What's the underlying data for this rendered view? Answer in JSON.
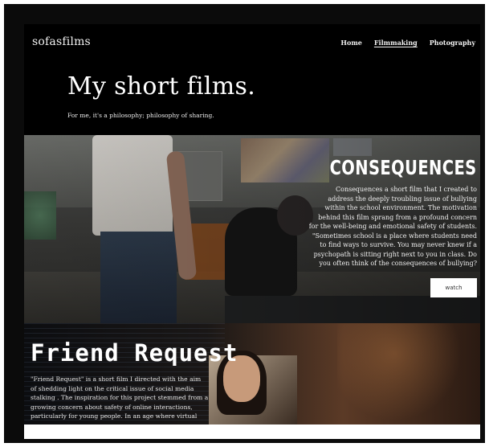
{
  "nav": {
    "brand": "sofasfilms",
    "links": [
      {
        "label": "Home",
        "active": false
      },
      {
        "label": "Filmmaking",
        "active": true
      },
      {
        "label": "Photography",
        "active": false
      }
    ]
  },
  "hero": {
    "title": "My short films.",
    "subtitle": "For me, it's a philosophy; philosophy of sharing."
  },
  "films": [
    {
      "title": "CONSEQUENCES",
      "description": "Consequences a short film that I created to address the deeply troubling issue of bullying within the school environment. The motivation behind this film sprang from a profound concern for the well-being and emotional safety of students. \"Sometimes school is a place where students need to find ways to survive. You may never knew if a psychopath is sitting right next to you in class. Do you often think of the consequences of bullying?",
      "button": "watch"
    },
    {
      "title": "Friend Request",
      "description": "\"Friend Request\" is a short film I directed with the aim of shedding light on the critical issue of social media stalking . The inspiration for this project stemmed from a growing concern about safety of online interactions, particularly for young people. In an age where virtual"
    }
  ],
  "colors": {
    "background": "#000000",
    "button_bg": "#ffffff",
    "text": "#ffffff"
  }
}
